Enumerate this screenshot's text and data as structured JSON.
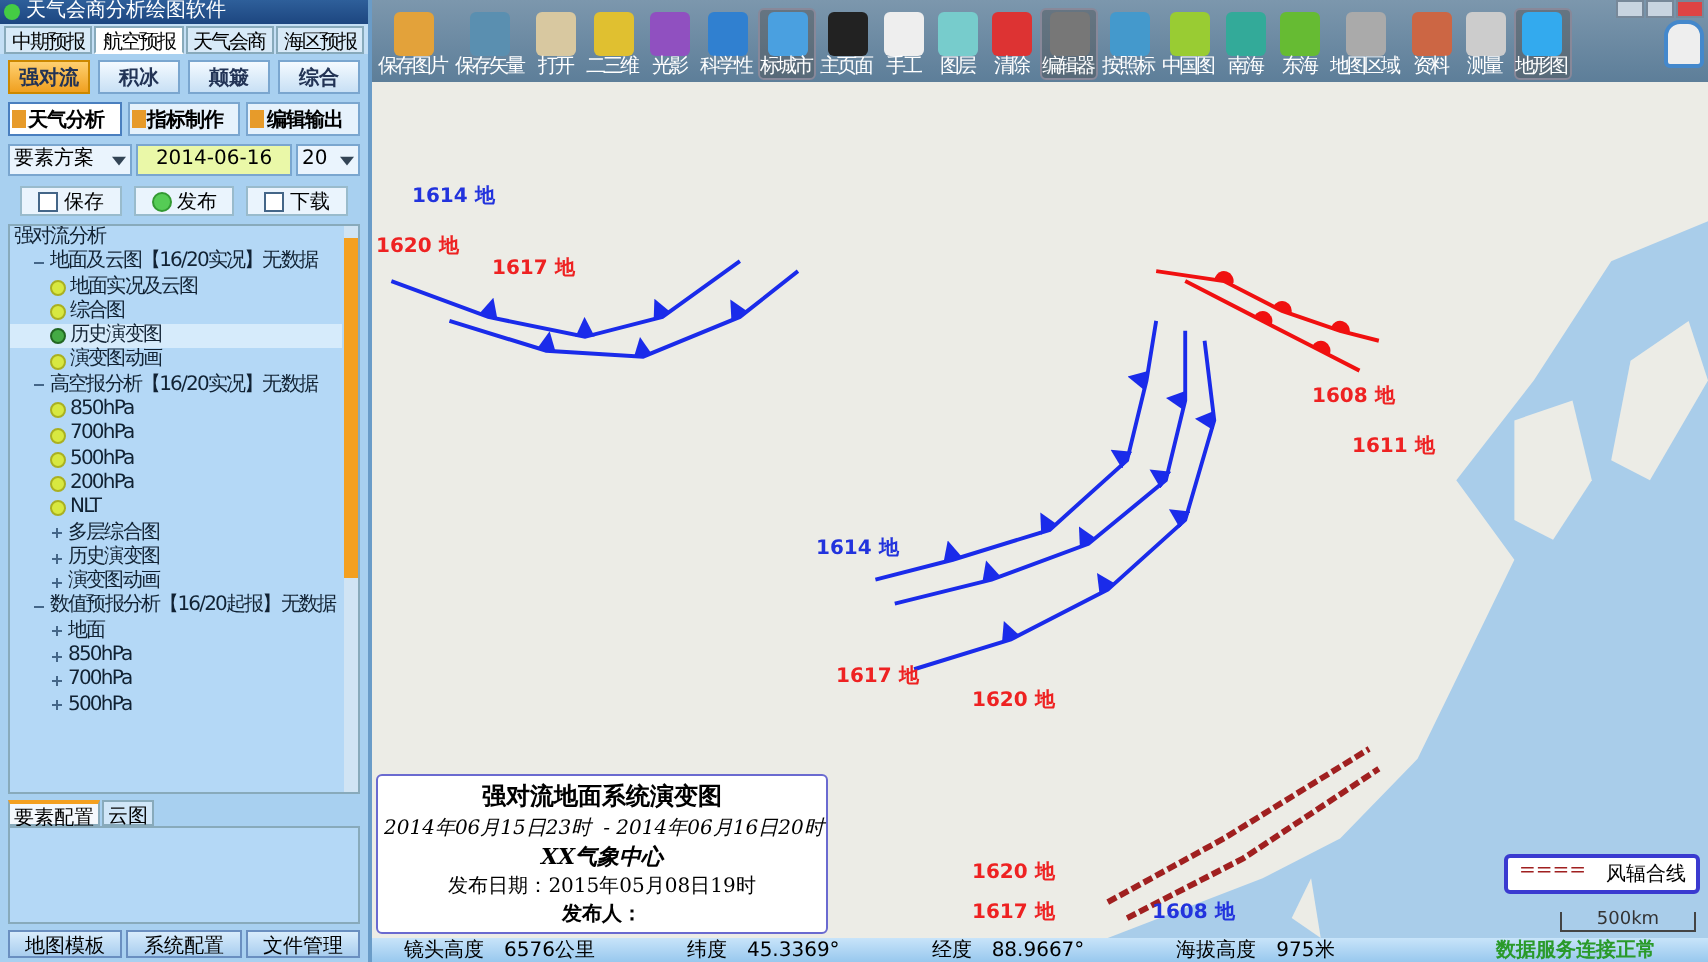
{
  "window": {
    "title": "天气会商分析绘图软件"
  },
  "module_tabs": [
    {
      "label": "中期预报",
      "selected": false
    },
    {
      "label": "航空预报",
      "selected": true
    },
    {
      "label": "天气会商",
      "selected": false
    },
    {
      "label": "海区预报",
      "selected": false
    }
  ],
  "category_buttons": [
    {
      "label": "强对流",
      "selected": true
    },
    {
      "label": "积冰",
      "selected": false
    },
    {
      "label": "颠簸",
      "selected": false
    },
    {
      "label": "综合",
      "selected": false
    }
  ],
  "function_buttons": [
    {
      "label": "天气分析",
      "selected": true
    },
    {
      "label": "指标制作",
      "selected": false
    },
    {
      "label": "编辑输出",
      "selected": false
    }
  ],
  "scheme_select": {
    "value": "要素方案"
  },
  "date_field": {
    "value": "2014-06-16"
  },
  "hour_select": {
    "value": "20"
  },
  "action_buttons": [
    "保存",
    "发布",
    "下载"
  ],
  "tree": [
    {
      "label": "强对流分析",
      "children": [
        {
          "label": "地面及云图【16/20实况】无数据",
          "expanded": true,
          "children": [
            {
              "label": "地面实况及云图",
              "selected": false
            },
            {
              "label": "综合图",
              "selected": false
            },
            {
              "label": "历史演变图",
              "selected": true
            },
            {
              "label": "演变图动画",
              "selected": false
            }
          ]
        },
        {
          "label": "高空报分析【16/20实况】无数据",
          "expanded": true,
          "children": [
            {
              "label": "850hPa",
              "selected": false
            },
            {
              "label": "700hPa",
              "selected": false
            },
            {
              "label": "500hPa",
              "selected": false
            },
            {
              "label": "200hPa",
              "selected": false
            },
            {
              "label": "NLT",
              "selected": false
            },
            {
              "label": "多层综合图",
              "expanded": false
            },
            {
              "label": "历史演变图",
              "expanded": false
            },
            {
              "label": "演变图动画",
              "expanded": false
            }
          ]
        },
        {
          "label": "数值预报分析【16/20起报】无数据",
          "expanded": true,
          "children": [
            {
              "label": "地面",
              "expanded": false
            },
            {
              "label": "850hPa",
              "expanded": false
            },
            {
              "label": "700hPa",
              "expanded": false
            },
            {
              "label": "500hPa",
              "expanded": false
            }
          ]
        }
      ]
    }
  ],
  "config_tabs": [
    {
      "label": "要素配置",
      "selected": true
    },
    {
      "label": "云图",
      "selected": false
    }
  ],
  "bottom_buttons": [
    "地图模板",
    "系统配置",
    "文件管理"
  ],
  "toolbar": [
    {
      "label": "保存图片",
      "selected": false
    },
    {
      "label": "保存矢量",
      "selected": false
    },
    {
      "label": "打开",
      "selected": false
    },
    {
      "label": "二三维",
      "selected": false
    },
    {
      "label": "光影",
      "selected": false
    },
    {
      "label": "科学性",
      "selected": false
    },
    {
      "label": "标城市",
      "selected": true
    },
    {
      "label": "主页面",
      "selected": false
    },
    {
      "label": "手工",
      "selected": false
    },
    {
      "label": "图层",
      "selected": false
    },
    {
      "label": "清除",
      "selected": false
    },
    {
      "label": "编辑器",
      "selected": true
    },
    {
      "label": "按照标",
      "selected": false
    },
    {
      "label": "中国图",
      "selected": false
    },
    {
      "label": "南海",
      "selected": false
    },
    {
      "label": "东海",
      "selected": false
    },
    {
      "label": "地图区域",
      "selected": false
    },
    {
      "label": "资料",
      "selected": false
    },
    {
      "label": "测量",
      "selected": false
    },
    {
      "label": "地形图",
      "selected": true
    }
  ],
  "map": {
    "front_labels": [
      {
        "text": "1614 地",
        "color": "#2233dd"
      },
      {
        "text": "1620 地",
        "color": "#ee2222"
      },
      {
        "text": "1617 地",
        "color": "#ee2222"
      },
      {
        "text": "1608 地",
        "color": "#ee2222"
      },
      {
        "text": "1611 地",
        "color": "#ee2222"
      },
      {
        "text": "1614 地",
        "color": "#2233dd"
      },
      {
        "text": "1617 地",
        "color": "#ee2222"
      },
      {
        "text": "1620 地",
        "color": "#ee2222"
      },
      {
        "text": "1620 地",
        "color": "#ee2222"
      },
      {
        "text": "1617 地",
        "color": "#ee2222"
      },
      {
        "text": "1608 地",
        "color": "#2233dd"
      }
    ],
    "legend": {
      "symbol": "====",
      "label": "风辐合线"
    },
    "scale": "500km"
  },
  "title_box": {
    "title": "强对流地面系统演变图",
    "start": "2014年06月15日23时",
    "end": "- 2014年06月16日20时",
    "center": "XX气象中心",
    "date": "发布日期：2015年05月08日19时",
    "publisher": "发布人："
  },
  "status_bar": [
    {
      "label": "镜头高度",
      "value": "6576公里"
    },
    {
      "label": "纬度",
      "value": "45.3369°"
    },
    {
      "label": "经度",
      "value": "88.9667°"
    },
    {
      "label": "海拔高度",
      "value": "975米"
    }
  ],
  "connection_status": "数据服务连接正常"
}
